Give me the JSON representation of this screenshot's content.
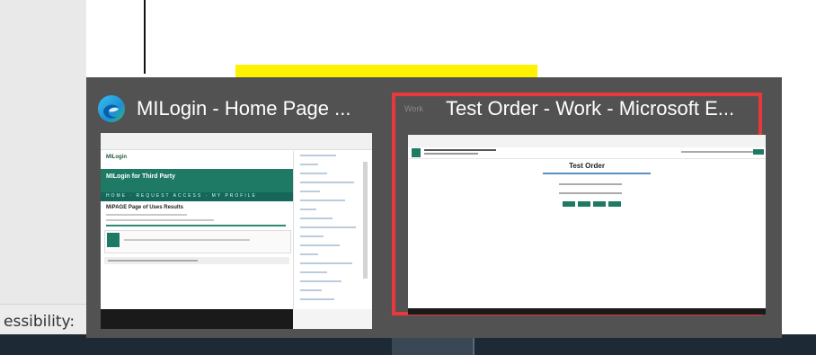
{
  "background": {
    "status_text": "essibility:"
  },
  "switcher": {
    "items": [
      {
        "title": "MILogin - Home Page ...",
        "icon": "edge-icon",
        "thumbnail": {
          "site_name": "MILogin",
          "band_title": "MILogin for Third Party",
          "nav_text": "HOME · REQUEST ACCESS · MY PROFILE",
          "heading": "MiPAGE Page of Uses Results"
        }
      },
      {
        "title": "Test Order - Work - Microsoft E...",
        "icon": "edge-work-icon",
        "badge": "Work",
        "selected": true,
        "thumbnail": {
          "heading": "Test Order"
        }
      }
    ]
  },
  "colors": {
    "flyout_bg": "#525252",
    "selection_border": "#e8383c",
    "accent_green": "#1e7a64",
    "highlight": "#fff200",
    "taskbar": "#1d2a36"
  }
}
